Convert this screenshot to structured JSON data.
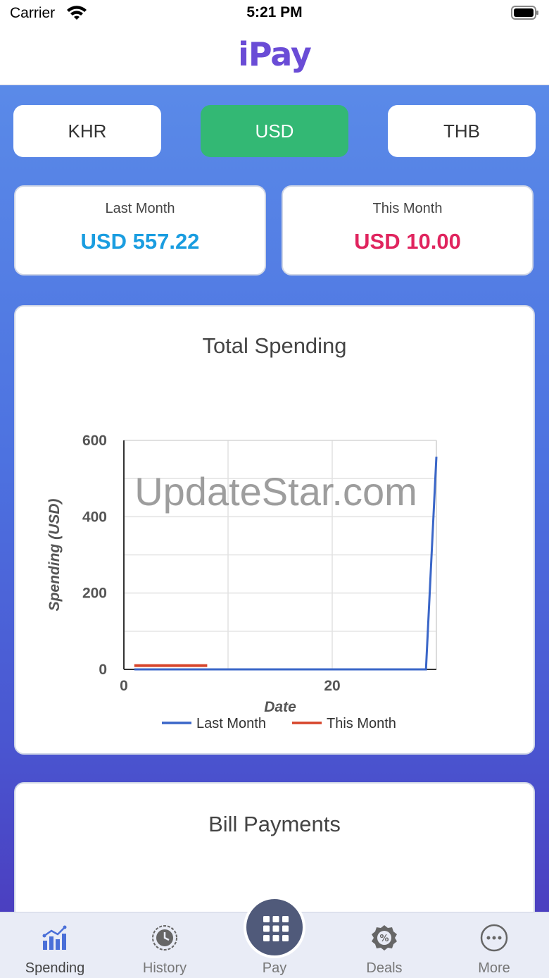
{
  "status_bar": {
    "carrier": "Carrier",
    "time": "5:21 PM"
  },
  "header": {
    "logo": "iPay"
  },
  "currency_tabs": [
    {
      "label": "KHR",
      "active": false
    },
    {
      "label": "USD",
      "active": true
    },
    {
      "label": "THB",
      "active": false
    }
  ],
  "summary": {
    "last_month": {
      "label": "Last Month",
      "value": "USD 557.22"
    },
    "this_month": {
      "label": "This Month",
      "value": "USD 10.00"
    }
  },
  "chart_card": {
    "title": "Total Spending"
  },
  "watermark": "UpdateStar.com",
  "chart_data": {
    "type": "line",
    "title": "Total Spending",
    "xlabel": "Date",
    "ylabel": "Spending (USD)",
    "xlim": [
      0,
      30
    ],
    "ylim": [
      0,
      600
    ],
    "x_ticks": [
      0,
      20
    ],
    "y_ticks": [
      0,
      200,
      400,
      600
    ],
    "grid": true,
    "legend_position": "bottom",
    "series": [
      {
        "name": "Last Month",
        "color": "#3a66c8",
        "points": [
          [
            1,
            0
          ],
          [
            29,
            0
          ],
          [
            30,
            557.22
          ]
        ]
      },
      {
        "name": "This Month",
        "color": "#d6442a",
        "points": [
          [
            1,
            10
          ],
          [
            8,
            10
          ]
        ]
      }
    ]
  },
  "bill_card": {
    "title": "Bill Payments"
  },
  "tab_bar": {
    "items": [
      {
        "label": "Spending",
        "icon": "chart-bars-icon",
        "active": true
      },
      {
        "label": "History",
        "icon": "clock-icon",
        "active": false
      },
      {
        "label": "Pay",
        "icon": "grid-icon",
        "active": false
      },
      {
        "label": "Deals",
        "icon": "percent-badge-icon",
        "active": false
      },
      {
        "label": "More",
        "icon": "ellipsis-circle-icon",
        "active": false
      }
    ]
  },
  "colors": {
    "accent_active": "#33b874",
    "last_month_value": "#1a9de0",
    "this_month_value": "#e0245e",
    "brand": "#6a4cd6"
  }
}
